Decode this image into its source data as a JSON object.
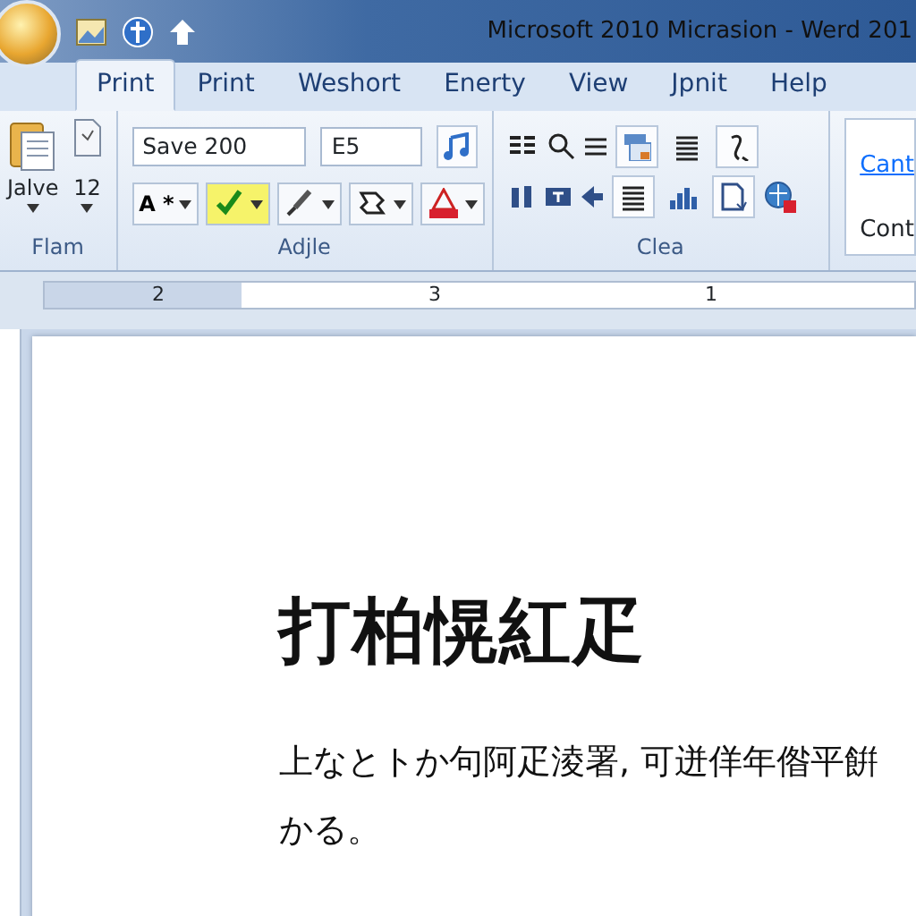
{
  "window": {
    "title": "Microsoft 2010 Micrasion - Werd 201"
  },
  "tabs": [
    {
      "label": "Print",
      "selected": true
    },
    {
      "label": "Print",
      "selected": false
    },
    {
      "label": "Weshort",
      "selected": false
    },
    {
      "label": "Enerty",
      "selected": false
    },
    {
      "label": "View",
      "selected": false
    },
    {
      "label": "Jpnit",
      "selected": false
    },
    {
      "label": "Help",
      "selected": false
    }
  ],
  "ribbon": {
    "clipboard": {
      "label": "Flam",
      "paste_label": "Jalve",
      "size_label": "12"
    },
    "font": {
      "label": "Adjle",
      "font_name": "Save 200",
      "font_size": "E5",
      "style_label": "A *",
      "tools": [
        {
          "kind": "highlight",
          "selected": true
        },
        {
          "kind": "brush",
          "selected": false
        },
        {
          "kind": "shape",
          "selected": false
        },
        {
          "kind": "color",
          "selected": false
        }
      ]
    },
    "paragraph": {
      "label": "Clea",
      "toggles": [
        {
          "selected": true
        },
        {
          "selected": false
        },
        {
          "selected": true
        },
        {
          "selected": true
        },
        {
          "selected": false
        },
        {
          "selected": true
        }
      ]
    },
    "styles": [
      "Cant",
      "Cont"
    ]
  },
  "ruler": {
    "numbers": [
      "2",
      "3",
      "1"
    ]
  },
  "document": {
    "heading": "打柏愰紅疋",
    "paragraph_lines": [
      "上なとトか句阿疋淩署, 可迸佯年偺平餠",
      "かる。"
    ]
  }
}
